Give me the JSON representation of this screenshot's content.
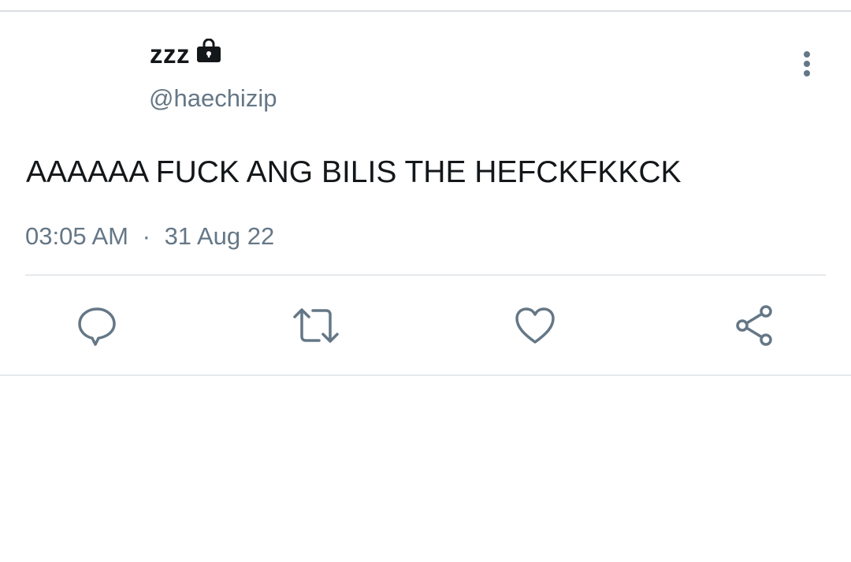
{
  "tweet": {
    "display_name": "zzz",
    "protected_icon": "lock-icon",
    "handle": "@haechizip",
    "text": "AAAAAA FUCK ANG BILIS THE HEFCKFKKCK",
    "time": "03:05 AM",
    "date_separator": "·",
    "date": "31 Aug 22"
  },
  "actions": [
    {
      "name": "reply",
      "icon": "speech-bubble-icon"
    },
    {
      "name": "retweet",
      "icon": "retweet-icon"
    },
    {
      "name": "like",
      "icon": "heart-icon"
    },
    {
      "name": "share",
      "icon": "share-icon"
    }
  ],
  "colors": {
    "text_primary": "#14171a",
    "text_secondary": "#657786",
    "divider": "#e6e9ec"
  }
}
